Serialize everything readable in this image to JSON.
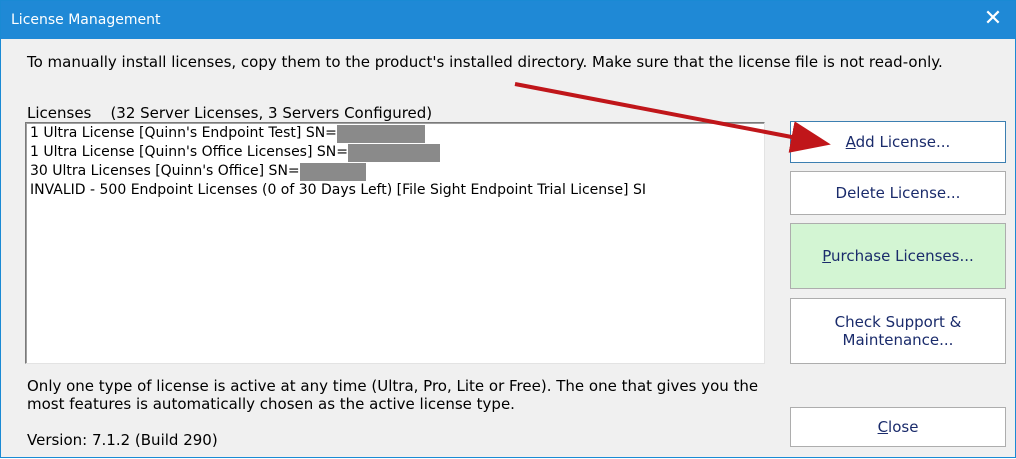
{
  "window": {
    "title": "License Management",
    "close_glyph": "✕"
  },
  "intro": {
    "text": "To manually install licenses, copy them to the product's installed directory.  Make sure that the license file is not read-only."
  },
  "licenses": {
    "label": "Licenses    (32 Server Licenses, 3 Servers Configured)",
    "items": [
      {
        "text": "1 Ultra License [Quinn's Endpoint Test] SN=",
        "redacted": true
      },
      {
        "text": "1 Ultra License [Quinn's Office Licenses] SN=",
        "redacted": true
      },
      {
        "text": "30 Ultra Licenses [Quinn's Office] SN=",
        "redacted": true
      },
      {
        "text": "INVALID - 500 Endpoint Licenses (0 of 30 Days Left) [File Sight Endpoint Trial License] SI",
        "redacted": false
      }
    ]
  },
  "buttons": {
    "add": {
      "mnemonic": "A",
      "rest": "dd License..."
    },
    "delete": {
      "label": "Delete License..."
    },
    "purchase": {
      "mnemonic": "P",
      "rest": "urchase Licenses..."
    },
    "support": {
      "line1": "Check Support &",
      "line2": "Maintenance..."
    },
    "close": {
      "mnemonic": "C",
      "rest": "lose"
    }
  },
  "footer": {
    "note": "Only one type of license is active at any time (Ultra, Pro, Lite or Free).  The one that gives you the most features is automatically chosen as the active license type.",
    "version": "Version: 7.1.2 (Build 290)"
  },
  "colors": {
    "titlebar": "#1f89d6",
    "purchase_bg": "#d3f5d3",
    "arrow": "#c0161a",
    "redaction": "#8a8a8a"
  }
}
